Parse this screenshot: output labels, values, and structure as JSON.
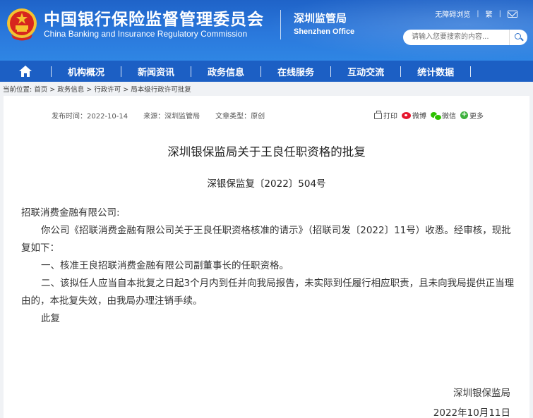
{
  "header": {
    "title_cn": "中国银行保险监督管理委员会",
    "title_en": "China Banking and Insurance Regulatory Commission",
    "office_cn": "深圳监管局",
    "office_en": "Shenzhen Office",
    "accessibility_label": "无障碍浏览",
    "traditional_label": "繁",
    "search_placeholder": "请输入您要搜索的内容...",
    "emblem_icon": "national-emblem-icon",
    "mail_icon": "mail-icon",
    "search_icon": "search-icon"
  },
  "nav": {
    "home_icon": "home-icon",
    "items": [
      "机构概况",
      "新闻资讯",
      "政务信息",
      "在线服务",
      "互动交流",
      "统计数据"
    ]
  },
  "breadcrumb": "当前位置:  首页 > 政务信息 > 行政许可 > 局本级行政许可批复",
  "article": {
    "publish_time": "发布时间：2022-10-14",
    "source": "来源：深圳监管局",
    "type": "文章类型：原创",
    "share": {
      "print": "打印",
      "weibo": "微博",
      "wechat": "微信",
      "more": "更多"
    },
    "title": "深圳银保监局关于王良任职资格的批复",
    "doc_number": "深银保监复〔2022〕504号",
    "addressee": "招联消费金融有限公司:",
    "paragraphs": [
      "你公司《招联消费金融有限公司关于王良任职资格核准的请示》（招联司发〔2022〕11号）收悉。经审核，现批复如下：",
      "一、核准王良招联消费金融有限公司副董事长的任职资格。",
      "二、该拟任人应当自本批复之日起3个月内到任并向我局报告，未实际到任履行相应职责，且未向我局提供正当理由的，本批复失效，由我局办理注销手续。",
      "此复"
    ],
    "signature": "深圳银保监局",
    "date": "2022年10月11日"
  },
  "colors": {
    "header_blue": "#2a78dc",
    "nav_blue": "#1c5fc4",
    "page_bg": "#f0f2f5"
  }
}
